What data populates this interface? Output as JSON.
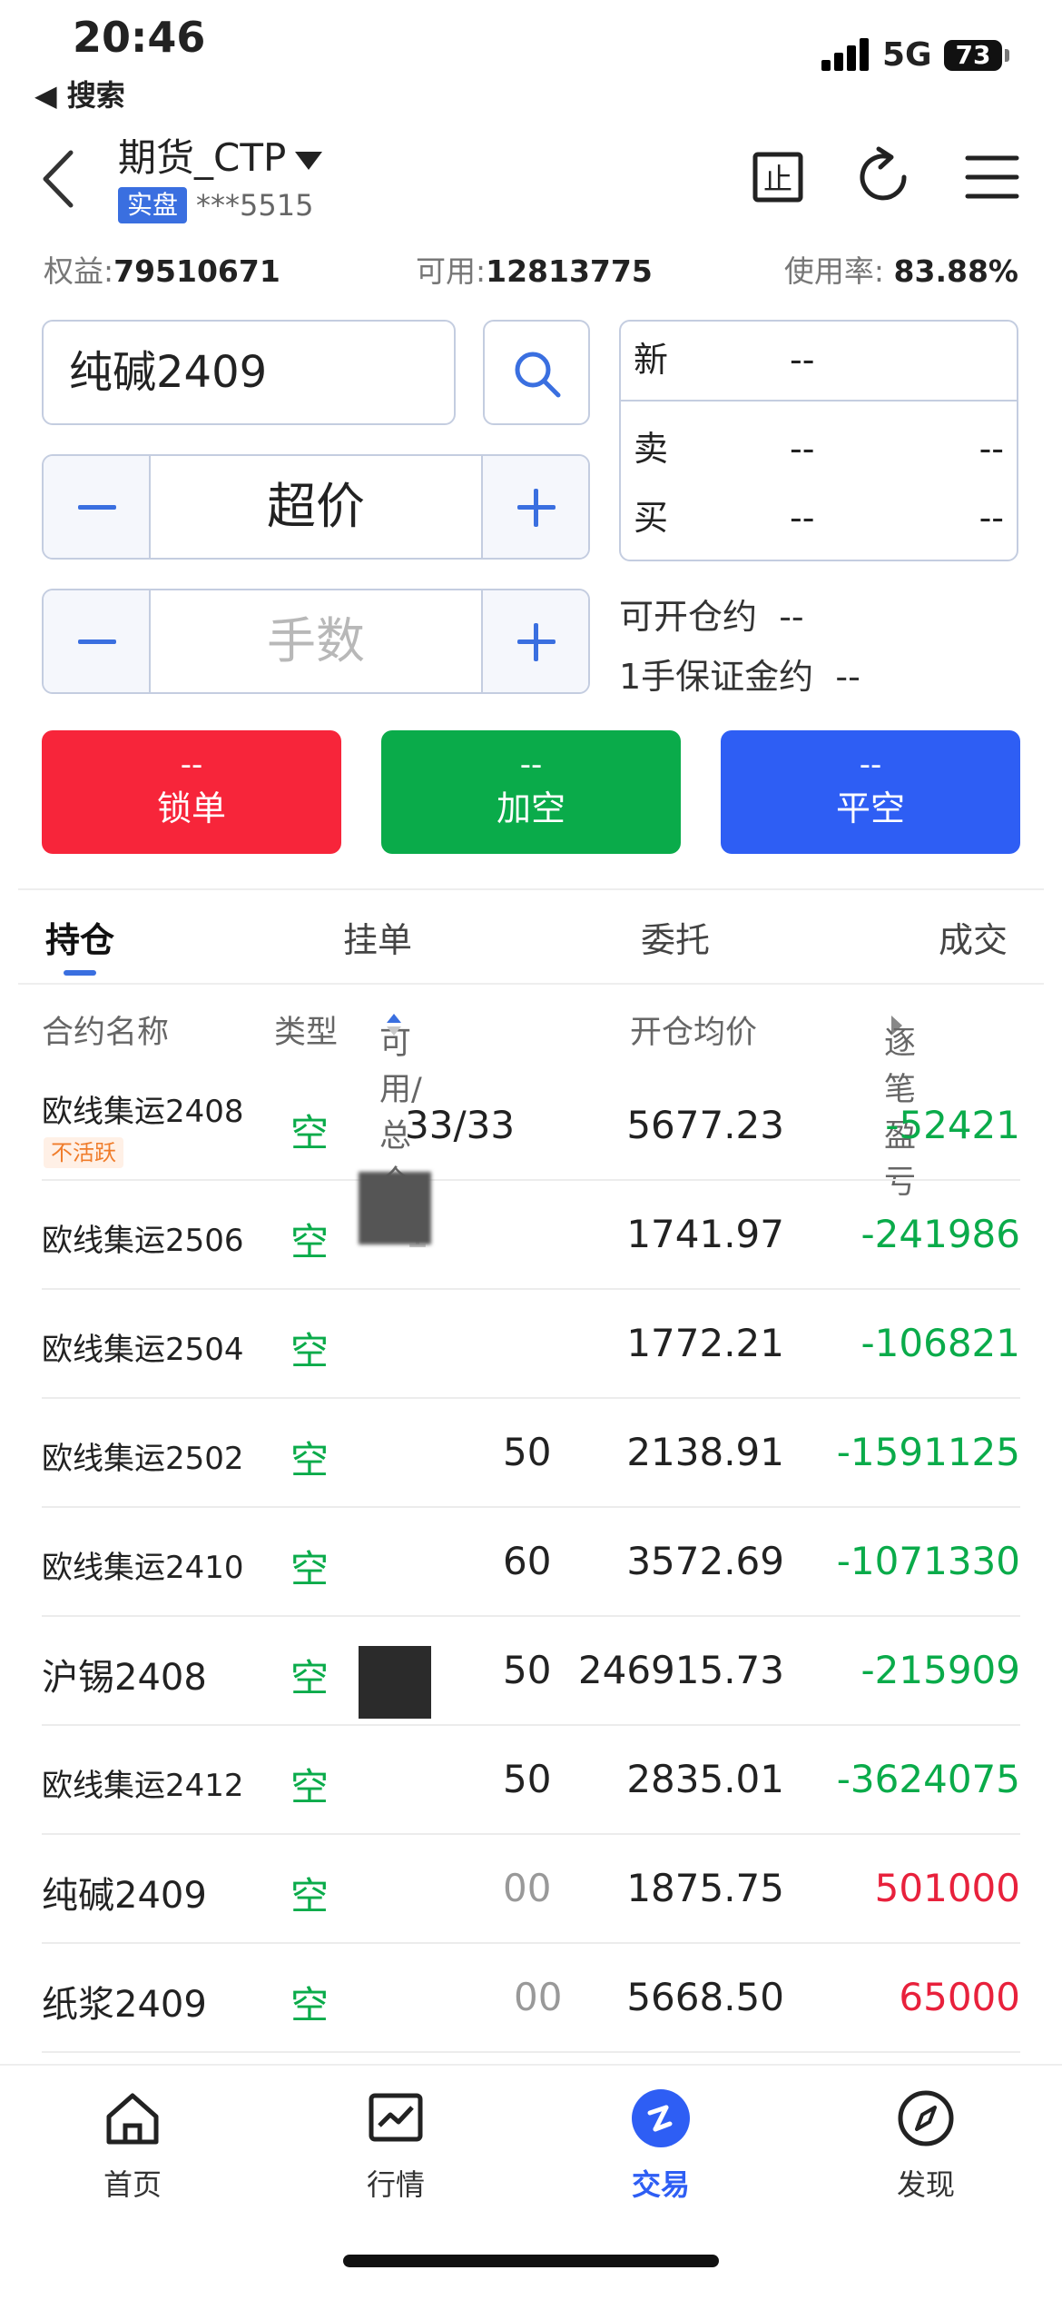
{
  "status_bar": {
    "time": "20:46",
    "back_app": "◀ 搜索",
    "network": "5G",
    "battery": "73"
  },
  "header": {
    "account_title": "期货_CTP",
    "badge": "实盘",
    "account_no": "***5515",
    "icons": [
      "stop-icon",
      "refresh-icon",
      "menu-icon"
    ],
    "stop_glyph": "止"
  },
  "summary": {
    "equity_label": "权益:",
    "equity_value": "79510671",
    "available_label": "可用:",
    "available_value": "12813775",
    "usage_label": "使用率:",
    "usage_value": "83.88%"
  },
  "order": {
    "contract": "纯碱2409",
    "price_mode": "超价",
    "qty_placeholder": "手数",
    "open_label": "可开仓约",
    "open_value": "--",
    "margin_label": "1手保证金约",
    "margin_value": "--"
  },
  "quote": {
    "last_label": "新",
    "last_value": "--",
    "ask_label": "卖",
    "ask_price": "--",
    "ask_vol": "--",
    "bid_label": "买",
    "bid_price": "--",
    "bid_vol": "--"
  },
  "actions": {
    "lock": {
      "price": "--",
      "label": "锁单",
      "color": "#f7253a"
    },
    "add_short": {
      "price": "--",
      "label": "加空",
      "color": "#0aab4a"
    },
    "close_short": {
      "price": "--",
      "label": "平空",
      "color": "#2e5ef4"
    }
  },
  "tabs": [
    "持仓",
    "挂单",
    "委托",
    "成交"
  ],
  "table": {
    "headers": [
      "合约名称",
      "类型",
      "可用/总仓",
      "开仓均价",
      "逐笔盈亏"
    ],
    "rows": [
      {
        "name": "欧线集运2408",
        "tag": "不活跃",
        "type": "空",
        "pos": "33/33",
        "avg": "5677.23",
        "pnl": "-52421"
      },
      {
        "name": "欧线集运2506",
        "type": "空",
        "pos": "1",
        "avg": "1741.97",
        "pnl": "-241986"
      },
      {
        "name": "欧线集运2504",
        "type": "空",
        "pos": "",
        "avg": "1772.21",
        "pnl": "-106821"
      },
      {
        "name": "欧线集运2502",
        "type": "空",
        "pos": "50",
        "avg": "2138.91",
        "pnl": "-1591125"
      },
      {
        "name": "欧线集运2410",
        "type": "空",
        "pos": "60",
        "avg": "3572.69",
        "pnl": "-1071330"
      },
      {
        "name": "沪锡2408",
        "type": "空",
        "pos": "50",
        "avg": "246915.73",
        "pnl": "-215909"
      },
      {
        "name": "欧线集运2412",
        "type": "空",
        "pos": "50",
        "avg": "2835.01",
        "pnl": "-3624075"
      },
      {
        "name": "纯碱2409",
        "type": "空",
        "pos": "00",
        "avg": "1875.75",
        "pnl": "501000"
      },
      {
        "name": "纸浆2409",
        "type": "空",
        "pos": "00",
        "avg": "5668.50",
        "pnl": "65000"
      }
    ]
  },
  "bottom_nav": [
    {
      "label": "首页",
      "icon": "home-icon"
    },
    {
      "label": "行情",
      "icon": "chart-icon"
    },
    {
      "label": "交易",
      "icon": "trade-icon"
    },
    {
      "label": "发现",
      "icon": "compass-icon"
    }
  ],
  "colors": {
    "accent": "#2e5ef4",
    "short": "#0aab4a",
    "loss": "#0aab4a",
    "profit": "#e8213c"
  }
}
